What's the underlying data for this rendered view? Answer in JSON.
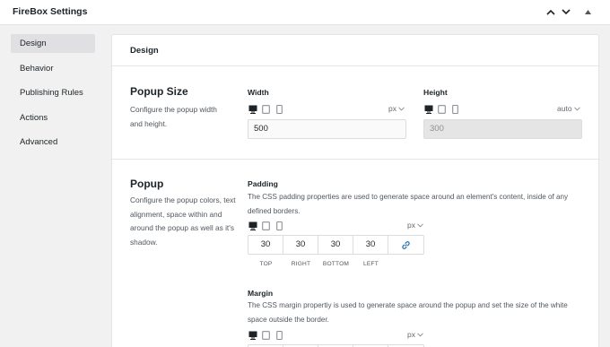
{
  "header": {
    "title": "FireBox Settings"
  },
  "colors": {
    "accent": "#2271b1",
    "active_nav_bg": "#e0e0e2"
  },
  "sidebar": {
    "items": [
      {
        "label": "Design",
        "active": true
      },
      {
        "label": "Behavior",
        "active": false
      },
      {
        "label": "Publishing Rules",
        "active": false
      },
      {
        "label": "Actions",
        "active": false
      },
      {
        "label": "Advanced",
        "active": false
      }
    ]
  },
  "main": {
    "title": "Design",
    "popup_size": {
      "title": "Popup Size",
      "description": "Configure the popup width and height.",
      "width": {
        "label": "Width",
        "unit": "px",
        "value": "500"
      },
      "height": {
        "label": "Height",
        "unit": "auto",
        "value": "300"
      }
    },
    "popup": {
      "title": "Popup",
      "description": "Configure the popup colors, text alignment, space within and around the popup as well as it's shadow.",
      "padding": {
        "label": "Padding",
        "help": "The CSS padding properties are used to generate space around an element's content, inside of any defined borders.",
        "unit": "px",
        "values": [
          "30",
          "30",
          "30",
          "30"
        ],
        "sides": [
          "TOP",
          "RIGHT",
          "BOTTOM",
          "LEFT"
        ]
      },
      "margin": {
        "label": "Margin",
        "help": "The CSS margin propertiy is used to generate space around the popup and set the size of the white space outside the border.",
        "unit": "px"
      }
    }
  }
}
